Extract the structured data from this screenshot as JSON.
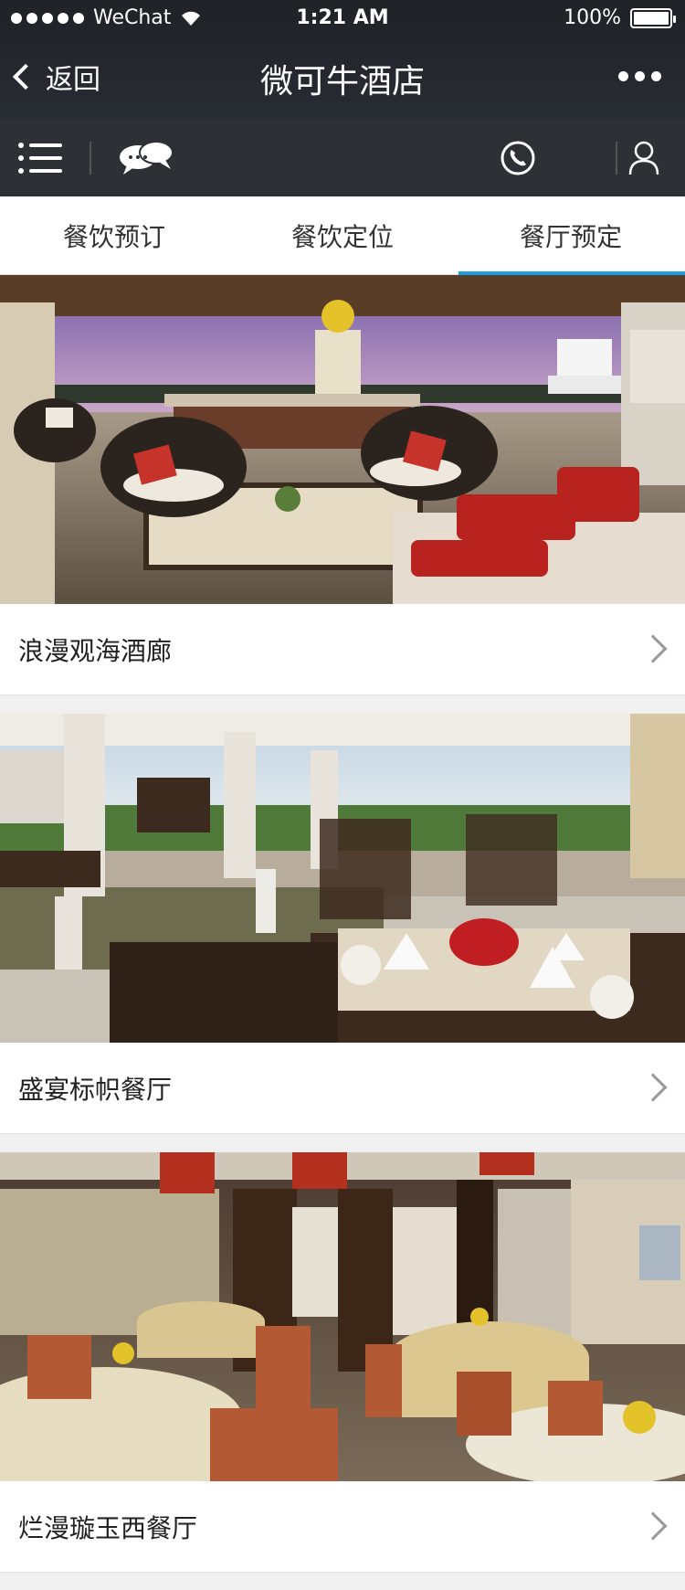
{
  "status_bar": {
    "carrier": "WeChat",
    "time": "1:21 AM",
    "battery": "100%"
  },
  "nav": {
    "back_label": "返回",
    "title": "微可牛酒店"
  },
  "toolbar": {
    "icons": [
      "menu-icon",
      "chat-icon",
      "phone-icon",
      "user-icon"
    ]
  },
  "tabs": [
    {
      "label": "餐饮预订",
      "active": false
    },
    {
      "label": "餐饮定位",
      "active": false
    },
    {
      "label": "餐厅预定",
      "active": true
    }
  ],
  "restaurants": [
    {
      "name": "浪漫观海酒廊"
    },
    {
      "name": "盛宴标帜餐厅"
    },
    {
      "name": "烂漫璇玉西餐厅"
    }
  ],
  "colors": {
    "header_bg": "#1f2227",
    "toolbar_bg": "#2d3035",
    "tab_accent": "#1a9fe0"
  }
}
